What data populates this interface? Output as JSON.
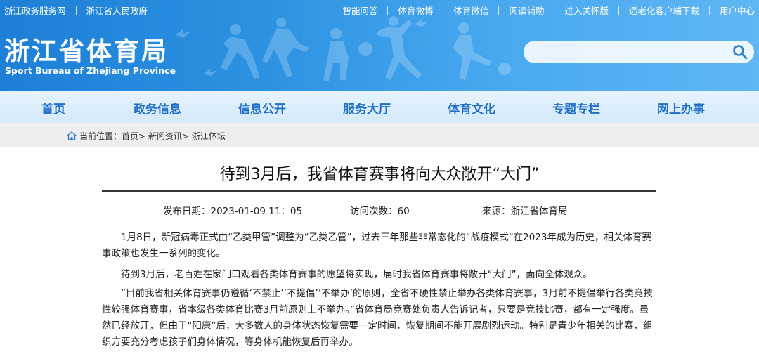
{
  "top_links": {
    "left": [
      "浙江政务服务网",
      "浙江省人民政府"
    ],
    "right": [
      "智能问答",
      "体育微博",
      "体育微信",
      "阅读辅助",
      "进入关怀版",
      "适老化客户端下载",
      "用户中心"
    ]
  },
  "logo": {
    "cn": "浙江省体育局",
    "en": "Sport Bureau of Zhejiang Province"
  },
  "search": {
    "placeholder": ""
  },
  "nav": [
    "首页",
    "政务信息",
    "信息公开",
    "服务大厅",
    "体育文化",
    "专题专栏",
    "网上办事"
  ],
  "breadcrumb": {
    "label": "当前位置：",
    "items": [
      "首页",
      "新闻资讯",
      "浙江体坛"
    ],
    "separator": ">"
  },
  "article": {
    "title": "待到3月后，我省体育赛事将向大众敞开“大门”",
    "meta": {
      "date": "发布日期：2023-01-09  11：05",
      "visits": "访问次数：60",
      "source": "来源：浙江省体育局"
    },
    "paragraphs": [
      "1月8日，新冠病毒正式由“乙类甲管”调整为“乙类乙管”，过去三年那些非常态化的“战疫模式”在2023年成为历史，相关体育赛事政策也发生一系列的变化。",
      "待到3月后，老百姓在家门口观看各类体育赛事的愿望将实现，届时我省体育赛事将敞开“大门”，面向全体观众。",
      "“目前我省相关体育赛事仍遵循‘不禁止’‘不提倡’‘不举办’的原则，全省不硬性禁止举办各类体育赛事，3月前不提倡举行各类竞技性较强体育赛事，省本级各类体育比赛3月前原则上不举办。”省体育局竞赛处负责人告诉记者，只要是竞技比赛，都有一定强度。虽然已经放开，但由于“阳康”后，大多数人的身体状态恢复需要一定时间，恢复期间不能开展剧烈运动。特别是青少年相关的比赛，组织方要充分考虑孩子们身体情况，等身体机能恢复后再举办。"
    ]
  },
  "colors": {
    "banner_start": "#1d7fd6",
    "banner_end": "#5fb6f3",
    "nav_text": "#1f6fc9",
    "nav_bg": "#dcedfb",
    "crumb_bg": "#eeeeee"
  }
}
